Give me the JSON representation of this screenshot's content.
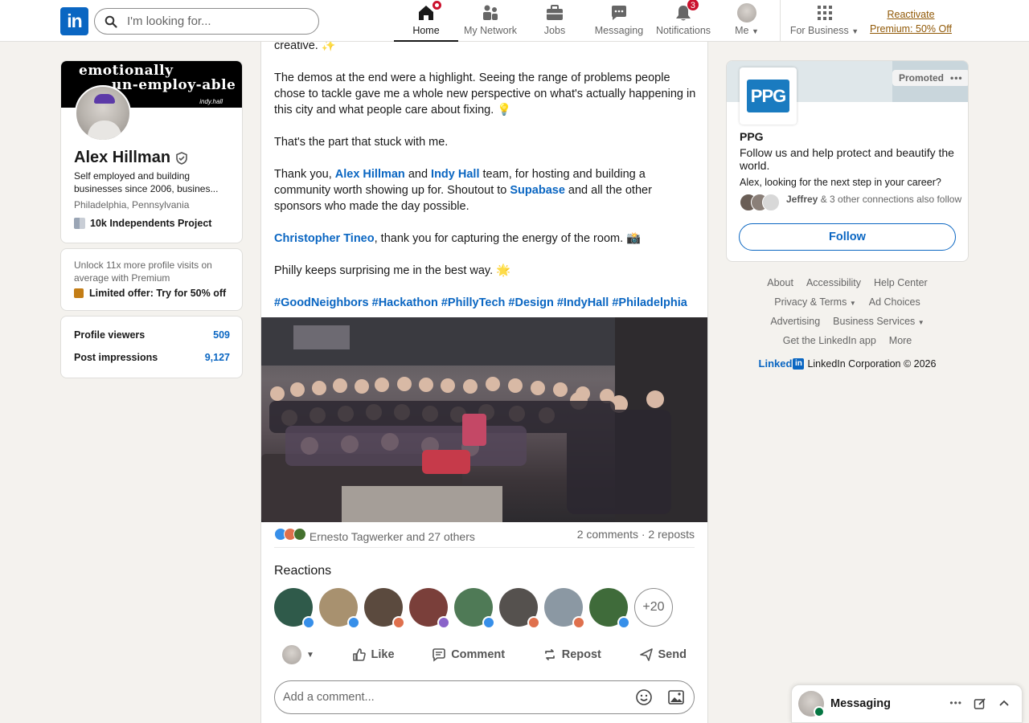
{
  "nav": {
    "search_placeholder": "I'm looking for...",
    "items": [
      {
        "label": "Home",
        "badge": ""
      },
      {
        "label": "My Network",
        "badge": ""
      },
      {
        "label": "Jobs",
        "badge": ""
      },
      {
        "label": "Messaging",
        "badge": ""
      },
      {
        "label": "Notifications",
        "badge": "3"
      },
      {
        "label": "Me",
        "badge": ""
      },
      {
        "label": "For Business",
        "badge": ""
      }
    ],
    "premium_line1": "Reactivate",
    "premium_line2": "Premium: 50% Off"
  },
  "profile": {
    "banner_line1": "emotionally",
    "banner_line2": "un-employ-able",
    "banner_sig": "indy.hall",
    "name": "Alex Hillman",
    "headline": "Self employed and building businesses since 2006, busines...",
    "location": "Philadelphia, Pennsylvania",
    "org": "10k Independents Project"
  },
  "premium_card": {
    "text": "Unlock 11x more profile visits on average with Premium",
    "link": "Limited offer: Try for 50% off"
  },
  "stats": {
    "viewers_label": "Profile viewers",
    "viewers": "509",
    "impressions_label": "Post impressions",
    "impressions": "9,127"
  },
  "post": {
    "p0": "creative. ✨",
    "p1": "The demos at the end were a highlight. Seeing the range of problems people chose to tackle gave me a whole new perspective on what's actually happening in this city and what people care about fixing. 💡",
    "p2": "That's the part that stuck with me.",
    "p3_a": "Thank you, ",
    "p3_m1": "Alex Hillman",
    "p3_b": " and ",
    "p3_m2": "Indy Hall",
    "p3_c": " team, for hosting and building a community worth showing up for. Shoutout to ",
    "p3_m3": "Supabase",
    "p3_d": " and all the other sponsors who made the day possible.",
    "p4_m": "Christopher Tineo",
    "p4_t": ", thank you for capturing the energy of the room. 📸",
    "p5": "Philly keeps surprising me in the best way. 🌟",
    "hashtags": "#GoodNeighbors #Hackathon #PhillyTech #Design #IndyHall #Philadelphia",
    "reactors": "Ernesto Tagwerker and 27 others",
    "comments_reposts": "2 comments · 2 reposts",
    "reactions_heading": "Reactions",
    "more_reactions": "+20",
    "actions": {
      "like": "Like",
      "comment": "Comment",
      "repost": "Repost",
      "send": "Send"
    },
    "comment_placeholder": "Add a comment..."
  },
  "ad": {
    "promoted": "Promoted",
    "logo_text": "PPG",
    "company": "PPG",
    "tagline": "Follow us and help protect and beautify the world.",
    "cta": "Alex, looking for the next step in your career?",
    "connections_name": "Jeffrey",
    "connections_rest": " & 3 other connections also follow",
    "follow": "Follow"
  },
  "footer": {
    "about": "About",
    "accessibility": "Accessibility",
    "help": "Help Center",
    "privacy": "Privacy & Terms",
    "adchoices": "Ad Choices",
    "advertising": "Advertising",
    "business": "Business Services",
    "app": "Get the LinkedIn app",
    "more": "More",
    "brand": "Linked",
    "brand_box": "in",
    "copyright": "LinkedIn Corporation © 2026"
  },
  "messaging": {
    "title": "Messaging"
  },
  "colors": {
    "brand": "#0a66c2",
    "premium": "#915907",
    "badge": "#cb112d",
    "background": "#f4f2ee"
  }
}
